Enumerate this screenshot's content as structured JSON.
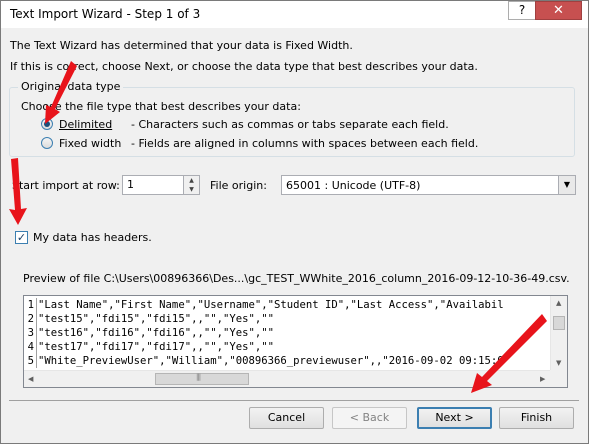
{
  "window": {
    "title": "Text Import Wizard - Step 1 of 3",
    "help_glyph": "?",
    "close_glyph": "✕"
  },
  "intro": {
    "line1": "The Text Wizard has determined that your data is Fixed Width.",
    "line2": "If this is correct, choose Next, or choose the data type that best describes your data."
  },
  "data_type_group": {
    "title": "Original data type",
    "prompt": "Choose the file type that best describes your data:",
    "options": [
      {
        "label": "Delimited",
        "description": "- Characters such as commas or tabs separate each field.",
        "selected": true
      },
      {
        "label": "Fixed width",
        "description": "- Fields are aligned in columns with spaces between each field.",
        "selected": false
      }
    ]
  },
  "start_row": {
    "label": "Start import at row:",
    "value": "1"
  },
  "file_origin": {
    "label": "File origin:",
    "value": "65001 : Unicode (UTF-8)"
  },
  "headers_checkbox": {
    "label": "My data has headers.",
    "checked": true,
    "mark": "✓"
  },
  "preview": {
    "label": "Preview of file C:\\Users\\00896366\\Des...\\gc_TEST_WWhite_2016_column_2016-09-12-10-36-49.csv.",
    "rows": [
      {
        "num": "1",
        "text": "\"Last Name\",\"First Name\",\"Username\",\"Student ID\",\"Last Access\",\"Availabil"
      },
      {
        "num": "2",
        "text": "\"test15\",\"fdi15\",\"fdi15\",,\"\",\"Yes\",\"\""
      },
      {
        "num": "3",
        "text": "\"test16\",\"fdi16\",\"fdi16\",,\"\",\"Yes\",\"\""
      },
      {
        "num": "4",
        "text": "\"test17\",\"fdi17\",\"fdi17\",,\"\",\"Yes\",\"\""
      },
      {
        "num": "5",
        "text": "\"White_PreviewUser\",\"William\",\"00896366_previewuser\",,\"2016-09-02 09:15:0"
      }
    ]
  },
  "buttons": {
    "cancel": "Cancel",
    "back": "< Back",
    "next": "Next >",
    "finish": "Finish"
  },
  "annotation_color": "#e8141b"
}
